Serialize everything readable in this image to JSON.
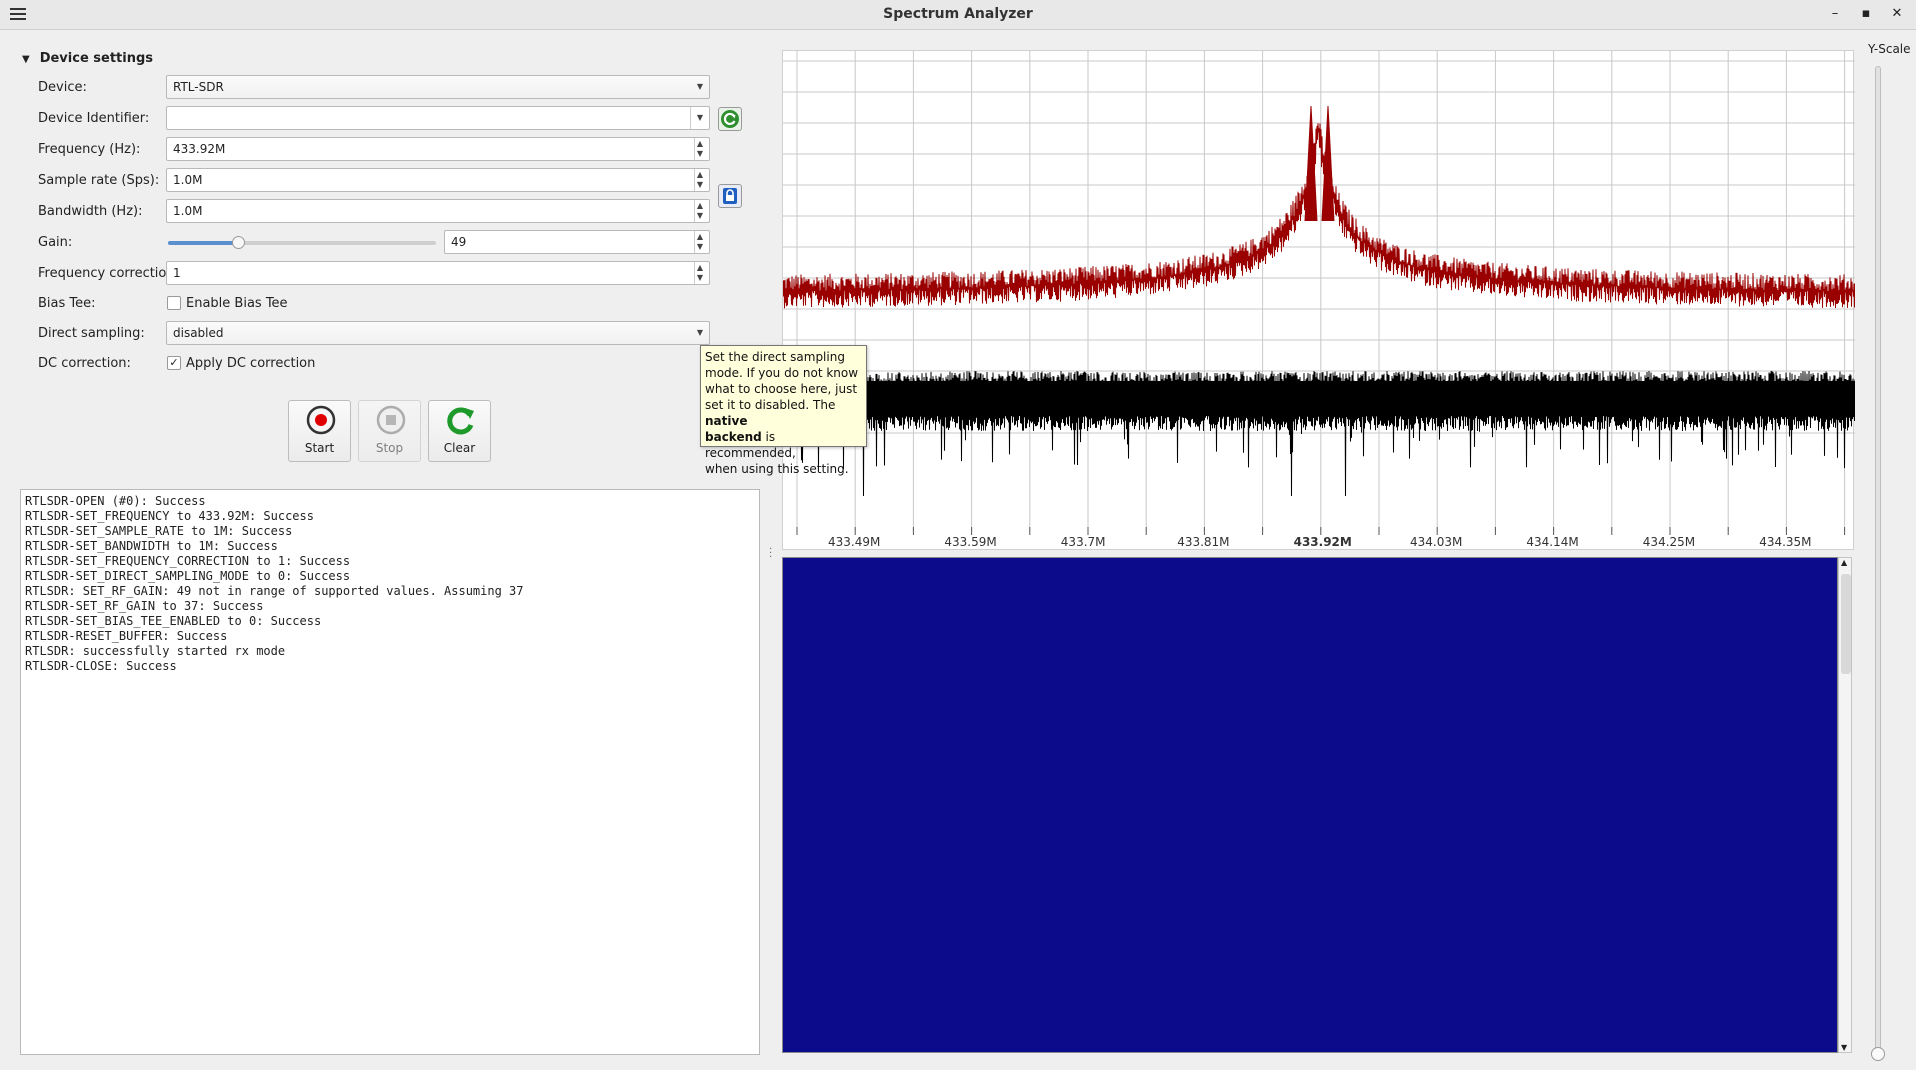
{
  "window": {
    "title": "Spectrum Analyzer",
    "minimize": "–",
    "maximize": "▪",
    "close": "✕"
  },
  "settings": {
    "section_title": "Device settings",
    "device_label": "Device:",
    "device_value": "RTL-SDR",
    "device_id_label": "Device Identifier:",
    "device_id_value": "",
    "frequency_label": "Frequency (Hz):",
    "frequency_value": "433.92M",
    "sample_rate_label": "Sample rate (Sps):",
    "sample_rate_value": "1.0M",
    "bandwidth_label": "Bandwidth (Hz):",
    "bandwidth_value": "1.0M",
    "gain_label": "Gain:",
    "gain_value": "49",
    "gain_slider_fraction": 0.26,
    "freq_correction_label": "Frequency correction:",
    "freq_correction_value": "1",
    "bias_tee_label": "Bias Tee:",
    "bias_tee_checkbox": "Enable Bias Tee",
    "bias_tee_checked": false,
    "direct_sampling_label": "Direct sampling:",
    "direct_sampling_value": "disabled",
    "dc_correction_label": "DC correction:",
    "dc_correction_checkbox": "Apply DC correction",
    "dc_correction_checked": true
  },
  "buttons": {
    "start": "Start",
    "stop": "Stop",
    "clear": "Clear"
  },
  "tooltip": {
    "line1": "Set the direct sampling",
    "line2": "mode. If you do not know",
    "line3": "what to choose here, just",
    "line4_pre": "set it to disabled. The ",
    "line4_bold": "native",
    "line5_bold": "backend",
    "line5_post": " is recommended,",
    "line6": "when using this setting."
  },
  "log": [
    "RTLSDR-OPEN (#0): Success",
    "RTLSDR-SET_FREQUENCY to 433.92M: Success",
    "RTLSDR-SET_SAMPLE_RATE to 1M: Success",
    "RTLSDR-SET_BANDWIDTH to 1M: Success",
    "RTLSDR-SET_FREQUENCY_CORRECTION to 1: Success",
    "RTLSDR-SET_DIRECT_SAMPLING_MODE to 0: Success",
    "RTLSDR: SET_RF_GAIN: 49 not in range of supported values. Assuming 37",
    "RTLSDR-SET_RF_GAIN to 37: Success",
    "RTLSDR-SET_BIAS_TEE_ENABLED to 0: Success",
    "RTLSDR-RESET_BUFFER: Success",
    "RTLSDR: successfully started rx mode",
    "RTLSDR-CLOSE: Success"
  ],
  "spectrum": {
    "x_ticks": [
      "433.49M",
      "433.59M",
      "433.7M",
      "433.81M",
      "433.92M",
      "434.03M",
      "434.14M",
      "434.25M",
      "434.35M"
    ],
    "center_tick": "433.92M",
    "y_scale_label": "Y-Scale",
    "colors": {
      "max_hold": "#9a0000",
      "current": "#000000",
      "waterfall": "#0b0b8c",
      "grid": "#c8c8c8"
    }
  },
  "chart_data": {
    "type": "line",
    "x_ticks": [
      "433.49M",
      "433.59M",
      "433.7M",
      "433.81M",
      "433.92M",
      "434.03M",
      "434.14M",
      "434.25M",
      "434.35M"
    ],
    "series": [
      {
        "color": "#9a0000",
        "shape": "peak centered at 433.92M with noise floor"
      },
      {
        "color": "#000000",
        "shape": "flat noise band with downward spikes"
      }
    ]
  }
}
